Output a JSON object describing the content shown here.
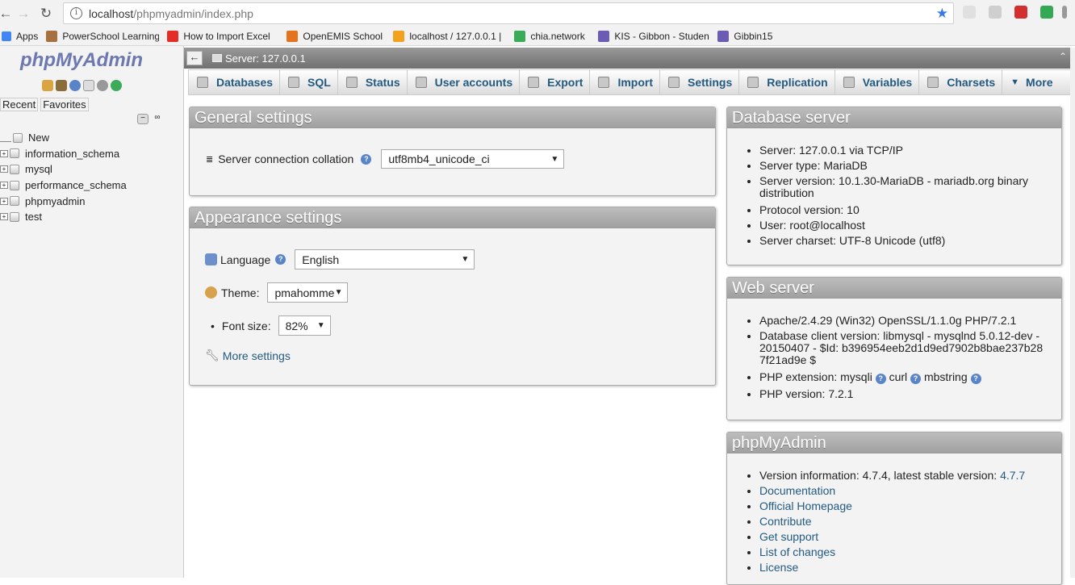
{
  "browser": {
    "url_host": "localhost",
    "url_path": "/phpmyadmin/index.php",
    "bookmarks": [
      {
        "label": "Apps",
        "color": "#4285f4"
      },
      {
        "label": "PowerSchool Learning",
        "color": "#a8703f"
      },
      {
        "label": "How to Import Excel",
        "color": "#e52d27"
      },
      {
        "label": "OpenEMIS School",
        "color": "#e3731c"
      },
      {
        "label": "localhost / 127.0.0.1 |",
        "color": "#f2a21e"
      },
      {
        "label": "chia.network",
        "color": "#3aac59"
      },
      {
        "label": "KIS - Gibbon - Studen",
        "color": "#6b5bb5"
      },
      {
        "label": "Gibbin15",
        "color": "#6b5bb5"
      }
    ]
  },
  "nav": {
    "logo_php": "php",
    "logo_my": "MyAdmin",
    "tab_recent": "Recent",
    "tab_favorites": "Favorites",
    "new_label": "New",
    "databases": [
      "information_schema",
      "mysql",
      "performance_schema",
      "phpmyadmin",
      "test"
    ]
  },
  "topbar": {
    "server_label": "Server: 127.0.0.1"
  },
  "menu": [
    {
      "label": "Databases"
    },
    {
      "label": "SQL"
    },
    {
      "label": "Status"
    },
    {
      "label": "User accounts"
    },
    {
      "label": "Export"
    },
    {
      "label": "Import"
    },
    {
      "label": "Settings"
    },
    {
      "label": "Replication"
    },
    {
      "label": "Variables"
    },
    {
      "label": "Charsets"
    },
    {
      "label": "More"
    }
  ],
  "general": {
    "title": "General settings",
    "collation_label": "Server connection collation",
    "collation_value": "utf8mb4_unicode_ci"
  },
  "appearance": {
    "title": "Appearance settings",
    "language_label": "Language",
    "language_value": "English",
    "theme_label": "Theme:",
    "theme_value": "pmahomme",
    "fontsize_label": "Font size:",
    "fontsize_value": "82%",
    "more_settings": "More settings"
  },
  "dbserver": {
    "title": "Database server",
    "items": [
      "Server: 127.0.0.1 via TCP/IP",
      "Server type: MariaDB",
      "Server version: 10.1.30-MariaDB - mariadb.org binary distribution",
      "Protocol version: 10",
      "User: root@localhost",
      "Server charset: UTF-8 Unicode (utf8)"
    ]
  },
  "webserver": {
    "title": "Web server",
    "items": [
      "Apache/2.4.29 (Win32) OpenSSL/1.1.0g PHP/7.2.1",
      "Database client version: libmysql - mysqlnd 5.0.12-dev - 20150407 - $Id: b396954eeb2d1d9ed7902b8bae237b287f21ad9e $"
    ],
    "php_ext_label": "PHP extension: mysqli",
    "php_ext_curl": "curl",
    "php_ext_mbstring": "mbstring",
    "php_version": "PHP version: 7.2.1"
  },
  "pma": {
    "title": "phpMyAdmin",
    "version_text": "Version information: 4.7.4, latest stable version:",
    "version_link": "4.7.7",
    "links": [
      "Documentation",
      "Official Homepage",
      "Contribute",
      "Get support",
      "List of changes",
      "License"
    ]
  }
}
